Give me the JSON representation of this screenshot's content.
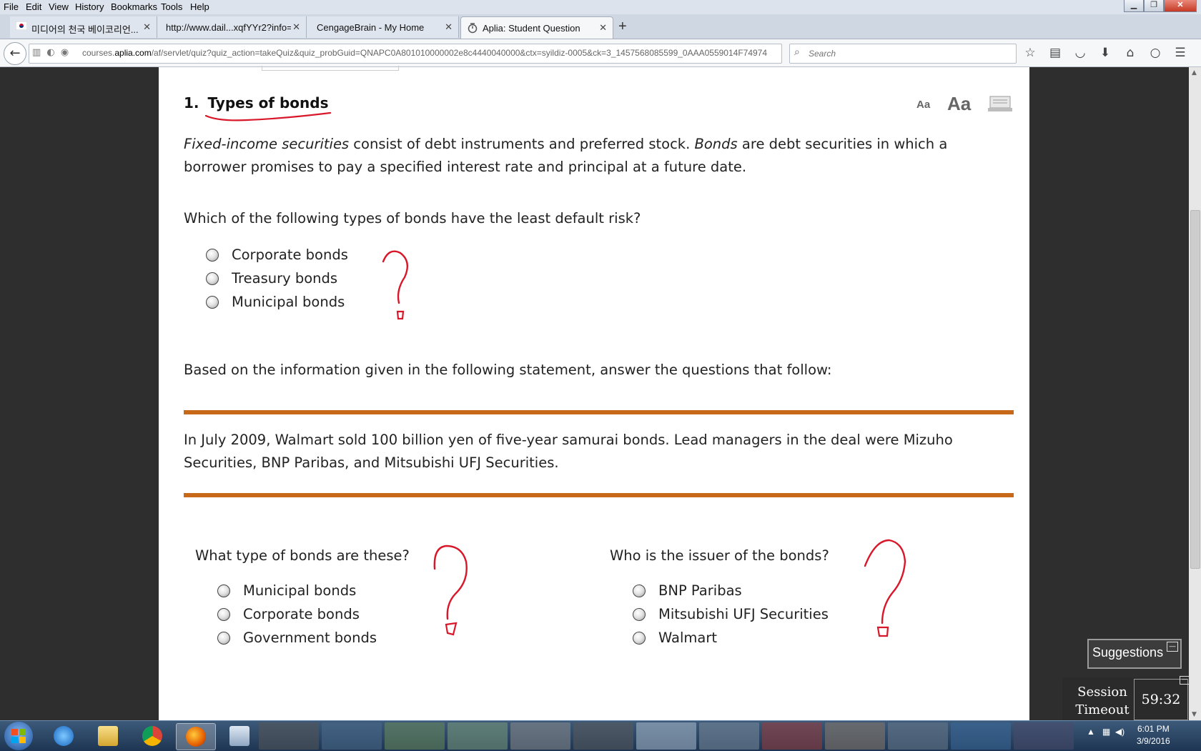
{
  "menubar": {
    "items": [
      "File",
      "Edit",
      "View",
      "History",
      "Bookmarks",
      "Tools",
      "Help"
    ]
  },
  "tabs": [
    {
      "label": "미디어의 천국 베이코리언...",
      "icon": "korea-flag-icon"
    },
    {
      "label": "http://www.dail...xqfYYr2?info=0",
      "icon": "page-icon"
    },
    {
      "label": "CengageBrain - My Home",
      "icon": "page-icon"
    },
    {
      "label": "Aplia: Student Question",
      "icon": "loading-icon"
    }
  ],
  "address": {
    "url_prefix": "courses.",
    "url_domain": "aplia.com",
    "url_rest": "/af/servlet/quiz?quiz_action=takeQuiz&quiz_probGuid=QNAPC0A801010000002e8c4440040000&ctx=syildiz-0005&ck=3_1457568085599_0AAA0559014F74974"
  },
  "search": {
    "placeholder": "Search"
  },
  "question": {
    "number": "1.",
    "title": "Types of bonds",
    "font_small_label": "Aa",
    "font_large_label": "Aa",
    "intro_term1": "Fixed-income securities",
    "intro_part1": " consist of debt instruments and preferred stock. ",
    "intro_term2": "Bonds",
    "intro_part2": " are debt securities in which a borrower promises to pay a specified interest rate and principal at a future date.",
    "stem": "Which of the following types of bonds have the least default risk?",
    "options": [
      "Corporate bonds",
      "Treasury bonds",
      "Municipal bonds"
    ],
    "stem2": "Based on the information given in the following statement, answer the questions that follow:",
    "statement": "In July 2009, Walmart sold 100 billion yen of five-year samurai bonds. Lead managers in the deal were Mizuho Securities, BNP Paribas, and Mitsubishi UFJ Securities.",
    "sub_q1": {
      "text": "What type of bonds are these?",
      "options": [
        "Municipal bonds",
        "Corporate bonds",
        "Government bonds"
      ]
    },
    "sub_q2": {
      "text": "Who is the issuer of the bonds?",
      "options": [
        "BNP Paribas",
        "Mitsubishi UFJ Securities",
        "Walmart"
      ]
    }
  },
  "widgets": {
    "suggestions_label": "Suggestions",
    "session_label": "Session Timeout",
    "session_time": "59:32"
  },
  "taskbar": {
    "time": "6:01 PM",
    "date": "3/9/2016"
  },
  "colors": {
    "accent_orange": "#c8691a",
    "annotation_red": "#d8182a"
  }
}
